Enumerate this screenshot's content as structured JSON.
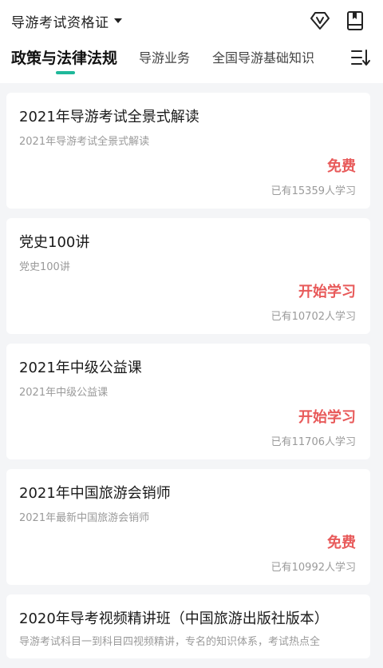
{
  "header": {
    "cert_label": "导游考试资格证",
    "icons": {
      "vip": "vip-diamond-icon",
      "book": "bookmark-book-icon",
      "sort": "sort-list-icon"
    }
  },
  "tabs": [
    {
      "label": "政策与法律法规",
      "active": true
    },
    {
      "label": "导游业务",
      "active": false
    },
    {
      "label": "全国导游基础知识",
      "active": false
    }
  ],
  "courses": [
    {
      "title": "2021年导游考试全景式解读",
      "subtitle": "2021年导游考试全景式解读",
      "price": "免费",
      "learners": "已有15359人学习"
    },
    {
      "title": "党史100讲",
      "subtitle": "党史100讲",
      "price": "开始学习",
      "learners": "已有10702人学习"
    },
    {
      "title": "2021年中级公益课",
      "subtitle": "2021年中级公益课",
      "price": "开始学习",
      "learners": "已有11706人学习"
    },
    {
      "title": "2021年中国旅游会销师",
      "subtitle": "2021年最新中国旅游会销师",
      "price": "免费",
      "learners": "已有10992人学习"
    },
    {
      "title": "2020年导考视频精讲班（中国旅游出版社版本）",
      "subtitle": "导游考试科目一到科目四视频精讲，专名的知识体系，考试热点全"
    }
  ],
  "colors": {
    "accent": "#1fb89a",
    "price": "#e85a5a",
    "background": "#f4f5f7"
  }
}
